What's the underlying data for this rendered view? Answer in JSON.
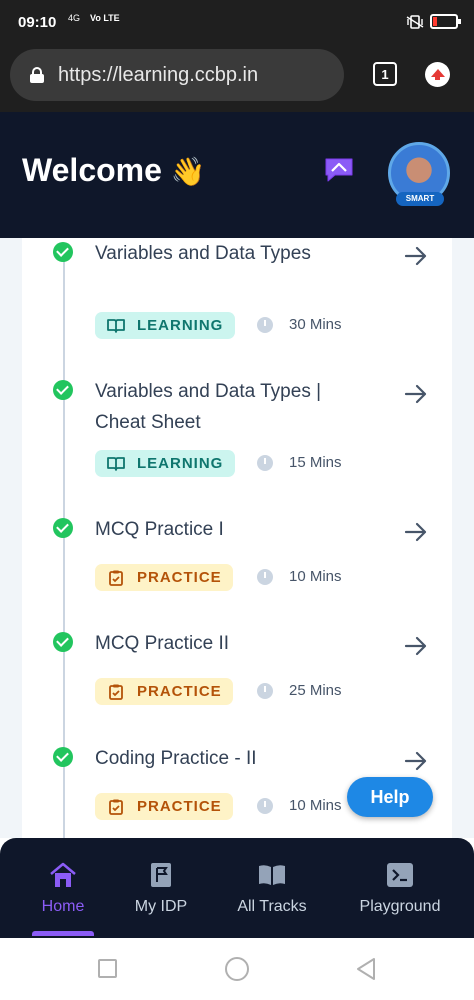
{
  "status_bar": {
    "time": "09:10",
    "network_top": "4G",
    "network_label": "Vo LTE"
  },
  "browser": {
    "url": "https://learning.ccbp.in",
    "tab_count": "1"
  },
  "header": {
    "title": "Welcome",
    "wave_emoji": "👋",
    "avatar_badge": "SMART"
  },
  "items": [
    {
      "title": "Variables and Data Types",
      "tag": "LEARNING",
      "tag_type": "learning",
      "duration": "30 Mins"
    },
    {
      "title": "Variables and Data Types | Cheat Sheet",
      "tag": "LEARNING",
      "tag_type": "learning",
      "duration": "15 Mins"
    },
    {
      "title": "MCQ Practice I",
      "tag": "PRACTICE",
      "tag_type": "practice",
      "duration": "10 Mins"
    },
    {
      "title": "MCQ Practice II",
      "tag": "PRACTICE",
      "tag_type": "practice",
      "duration": "25 Mins"
    },
    {
      "title": "Coding Practice - II",
      "tag": "PRACTICE",
      "tag_type": "practice",
      "duration": "10 Mins"
    }
  ],
  "help_button": "Help",
  "bottom_nav": {
    "items": [
      {
        "label": "Home",
        "icon": "home-icon",
        "active": true
      },
      {
        "label": "My IDP",
        "icon": "flag-icon",
        "active": false
      },
      {
        "label": "All Tracks",
        "icon": "book-icon",
        "active": false
      },
      {
        "label": "Playground",
        "icon": "terminal-icon",
        "active": false
      }
    ]
  },
  "colors": {
    "header_bg": "#0f172a",
    "accent": "#8b5cf6",
    "success": "#22c55e",
    "learning_bg": "#ccf5ef",
    "learning_fg": "#0f766e",
    "practice_bg": "#fef3c7",
    "practice_fg": "#b45309",
    "help_bg": "#1e88e5"
  }
}
